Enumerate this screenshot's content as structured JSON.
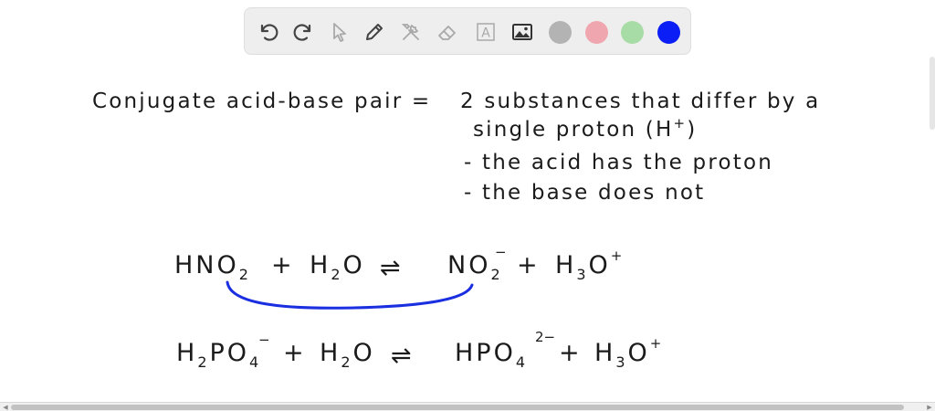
{
  "toolbar": {
    "tools": [
      {
        "name": "undo-icon",
        "enabled": true
      },
      {
        "name": "redo-icon",
        "enabled": true
      },
      {
        "name": "pointer-icon",
        "enabled": false
      },
      {
        "name": "pen-icon",
        "enabled": true
      },
      {
        "name": "tools-icon",
        "enabled": false
      },
      {
        "name": "eraser-icon",
        "enabled": false
      },
      {
        "name": "text-icon",
        "enabled": false
      },
      {
        "name": "image-icon",
        "enabled": true
      }
    ],
    "text_tool_glyph": "A",
    "colors": [
      "#b3b3b3",
      "#f0a6ae",
      "#a8dca6",
      "#0a1ef5"
    ],
    "selected_color": "#0a1ef5"
  },
  "notes": {
    "definition_term": "Conjugate acid-base pair =",
    "definition_line1": "2 substances that differ by a",
    "definition_line2": "single proton (H",
    "definition_line2_sup": "+",
    "definition_line2_end": ")",
    "point1": "- the acid has the proton",
    "point2": "- the base does not"
  },
  "equation1": {
    "acid": "HNO",
    "acid_sub": "2",
    "plus1": "+",
    "water": "H",
    "water_sub": "2",
    "water_end": "O",
    "arrow": "⇌",
    "base": "NO",
    "base_sub": "2",
    "base_sup": "−",
    "plus2": "+",
    "hydronium": "H",
    "hydronium_sub": "3",
    "hydronium_end": "O",
    "hydronium_sup": "+"
  },
  "equation2": {
    "acid_h": "H",
    "acid_h_sub": "2",
    "acid_po": "PO",
    "acid_sub": "4",
    "acid_sup": "−",
    "plus1": "+",
    "water": "H",
    "water_sub": "2",
    "water_end": "O",
    "arrow": "⇌",
    "base": "HPO",
    "base_sub": "4",
    "base_sup": "2−",
    "plus2": "+",
    "hydronium": "H",
    "hydronium_sub": "3",
    "hydronium_end": "O",
    "hydronium_sup": "+"
  },
  "annotation": {
    "bracket_color": "#1a2fe0"
  }
}
